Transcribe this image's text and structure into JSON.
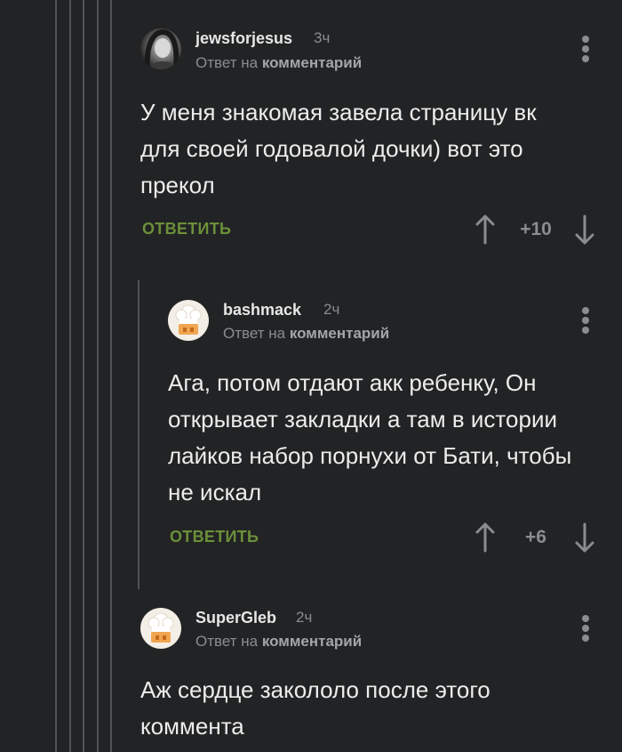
{
  "comments": [
    {
      "author": "jewsforjesus",
      "time": "3ч",
      "reply_prefix": "Ответ на ",
      "reply_target": "комментарий",
      "avatar": "user-photo-avatar",
      "lines": [
        "У меня знакомая завела страницу вк",
        "для своей годовалой дочки) вот это",
        "прекол"
      ],
      "reply_label": "ОТВЕТИТЬ",
      "score": "+10"
    },
    {
      "author": "bashmack",
      "time": "2ч",
      "reply_prefix": "Ответ на ",
      "reply_target": "комментарий",
      "avatar": "chef-hat-avatar",
      "lines": [
        "Ага, потом отдают акк ребенку, Он",
        "открывает закладки а там в истории",
        "лайков набор порнухи от Бати, чтобы",
        "не искал"
      ],
      "reply_label": "ОТВЕТИТЬ",
      "score": "+6"
    },
    {
      "author": "SuperGleb",
      "time": "2ч",
      "reply_prefix": "Ответ на ",
      "reply_target": "комментарий",
      "avatar": "chef-hat-avatar",
      "lines": [
        "Аж сердце закололо после этого",
        "коммента"
      ]
    }
  ],
  "icons": {
    "menu": "more-vertical-icon",
    "upvote": "arrow-up-icon",
    "downvote": "arrow-down-icon"
  },
  "colors": {
    "background": "#222324",
    "reply_button": "#6b8f3a",
    "muted_text": "#8a8c8e",
    "thread_line": "#505253"
  }
}
